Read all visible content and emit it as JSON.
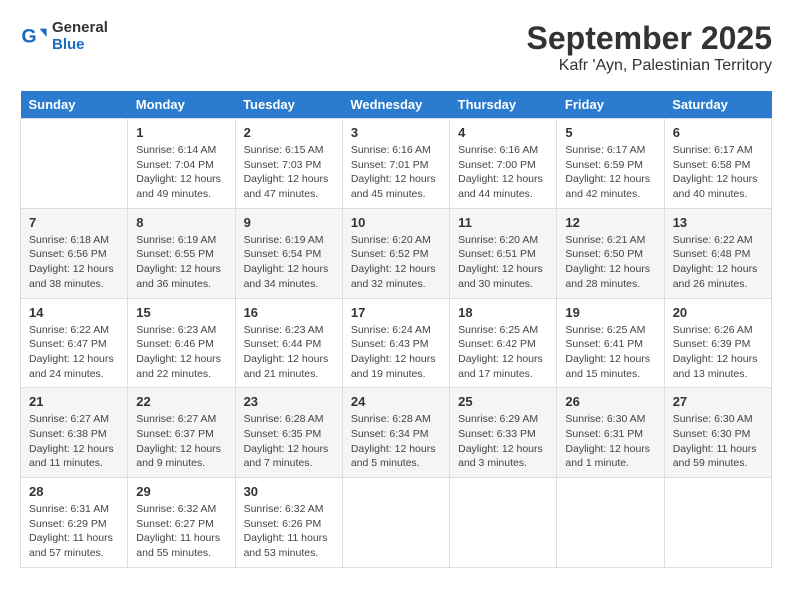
{
  "header": {
    "logo_general": "General",
    "logo_blue": "Blue",
    "title": "September 2025",
    "subtitle": "Kafr 'Ayn, Palestinian Territory"
  },
  "days_of_week": [
    "Sunday",
    "Monday",
    "Tuesday",
    "Wednesday",
    "Thursday",
    "Friday",
    "Saturday"
  ],
  "weeks": [
    [
      {
        "day": "",
        "info": ""
      },
      {
        "day": "1",
        "info": "Sunrise: 6:14 AM\nSunset: 7:04 PM\nDaylight: 12 hours\nand 49 minutes."
      },
      {
        "day": "2",
        "info": "Sunrise: 6:15 AM\nSunset: 7:03 PM\nDaylight: 12 hours\nand 47 minutes."
      },
      {
        "day": "3",
        "info": "Sunrise: 6:16 AM\nSunset: 7:01 PM\nDaylight: 12 hours\nand 45 minutes."
      },
      {
        "day": "4",
        "info": "Sunrise: 6:16 AM\nSunset: 7:00 PM\nDaylight: 12 hours\nand 44 minutes."
      },
      {
        "day": "5",
        "info": "Sunrise: 6:17 AM\nSunset: 6:59 PM\nDaylight: 12 hours\nand 42 minutes."
      },
      {
        "day": "6",
        "info": "Sunrise: 6:17 AM\nSunset: 6:58 PM\nDaylight: 12 hours\nand 40 minutes."
      }
    ],
    [
      {
        "day": "7",
        "info": "Sunrise: 6:18 AM\nSunset: 6:56 PM\nDaylight: 12 hours\nand 38 minutes."
      },
      {
        "day": "8",
        "info": "Sunrise: 6:19 AM\nSunset: 6:55 PM\nDaylight: 12 hours\nand 36 minutes."
      },
      {
        "day": "9",
        "info": "Sunrise: 6:19 AM\nSunset: 6:54 PM\nDaylight: 12 hours\nand 34 minutes."
      },
      {
        "day": "10",
        "info": "Sunrise: 6:20 AM\nSunset: 6:52 PM\nDaylight: 12 hours\nand 32 minutes."
      },
      {
        "day": "11",
        "info": "Sunrise: 6:20 AM\nSunset: 6:51 PM\nDaylight: 12 hours\nand 30 minutes."
      },
      {
        "day": "12",
        "info": "Sunrise: 6:21 AM\nSunset: 6:50 PM\nDaylight: 12 hours\nand 28 minutes."
      },
      {
        "day": "13",
        "info": "Sunrise: 6:22 AM\nSunset: 6:48 PM\nDaylight: 12 hours\nand 26 minutes."
      }
    ],
    [
      {
        "day": "14",
        "info": "Sunrise: 6:22 AM\nSunset: 6:47 PM\nDaylight: 12 hours\nand 24 minutes."
      },
      {
        "day": "15",
        "info": "Sunrise: 6:23 AM\nSunset: 6:46 PM\nDaylight: 12 hours\nand 22 minutes."
      },
      {
        "day": "16",
        "info": "Sunrise: 6:23 AM\nSunset: 6:44 PM\nDaylight: 12 hours\nand 21 minutes."
      },
      {
        "day": "17",
        "info": "Sunrise: 6:24 AM\nSunset: 6:43 PM\nDaylight: 12 hours\nand 19 minutes."
      },
      {
        "day": "18",
        "info": "Sunrise: 6:25 AM\nSunset: 6:42 PM\nDaylight: 12 hours\nand 17 minutes."
      },
      {
        "day": "19",
        "info": "Sunrise: 6:25 AM\nSunset: 6:41 PM\nDaylight: 12 hours\nand 15 minutes."
      },
      {
        "day": "20",
        "info": "Sunrise: 6:26 AM\nSunset: 6:39 PM\nDaylight: 12 hours\nand 13 minutes."
      }
    ],
    [
      {
        "day": "21",
        "info": "Sunrise: 6:27 AM\nSunset: 6:38 PM\nDaylight: 12 hours\nand 11 minutes."
      },
      {
        "day": "22",
        "info": "Sunrise: 6:27 AM\nSunset: 6:37 PM\nDaylight: 12 hours\nand 9 minutes."
      },
      {
        "day": "23",
        "info": "Sunrise: 6:28 AM\nSunset: 6:35 PM\nDaylight: 12 hours\nand 7 minutes."
      },
      {
        "day": "24",
        "info": "Sunrise: 6:28 AM\nSunset: 6:34 PM\nDaylight: 12 hours\nand 5 minutes."
      },
      {
        "day": "25",
        "info": "Sunrise: 6:29 AM\nSunset: 6:33 PM\nDaylight: 12 hours\nand 3 minutes."
      },
      {
        "day": "26",
        "info": "Sunrise: 6:30 AM\nSunset: 6:31 PM\nDaylight: 12 hours\nand 1 minute."
      },
      {
        "day": "27",
        "info": "Sunrise: 6:30 AM\nSunset: 6:30 PM\nDaylight: 11 hours\nand 59 minutes."
      }
    ],
    [
      {
        "day": "28",
        "info": "Sunrise: 6:31 AM\nSunset: 6:29 PM\nDaylight: 11 hours\nand 57 minutes."
      },
      {
        "day": "29",
        "info": "Sunrise: 6:32 AM\nSunset: 6:27 PM\nDaylight: 11 hours\nand 55 minutes."
      },
      {
        "day": "30",
        "info": "Sunrise: 6:32 AM\nSunset: 6:26 PM\nDaylight: 11 hours\nand 53 minutes."
      },
      {
        "day": "",
        "info": ""
      },
      {
        "day": "",
        "info": ""
      },
      {
        "day": "",
        "info": ""
      },
      {
        "day": "",
        "info": ""
      }
    ]
  ]
}
